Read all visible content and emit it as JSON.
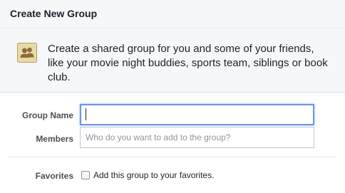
{
  "header": {
    "title": "Create New Group"
  },
  "info": {
    "icon": "group-people-icon",
    "text": "Create a shared group for you and some of your friends, like your movie night buddies, sports team, siblings or book club."
  },
  "form": {
    "group_name_label": "Group Name",
    "group_name_value": "",
    "members_label": "Members",
    "members_placeholder": "Who do you want to add to the group?",
    "favorites_label": "Favorites",
    "favorites_checkbox_text": "Add this group to your favorites.",
    "favorites_checked": false
  },
  "colors": {
    "header_bg": "#f6f7f9",
    "focus_border": "#6d97e6",
    "icon_bg": "#e9d9a6",
    "icon_figure": "#8b6d35"
  }
}
